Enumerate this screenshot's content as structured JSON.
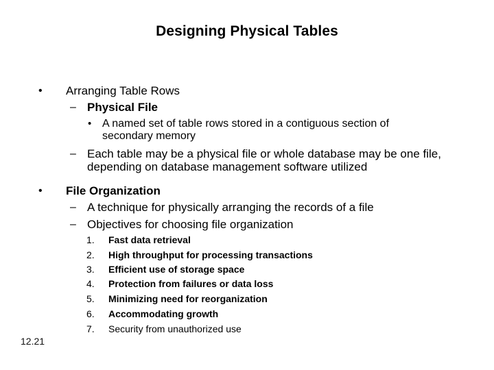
{
  "slide": {
    "title": "Designing Physical Tables",
    "slide_number": "12.21",
    "sections": [
      {
        "marker": "•",
        "heading": "Arranging Table Rows",
        "items": [
          {
            "marker": "–",
            "text": "Physical File",
            "subitems": [
              {
                "marker": "•",
                "line1": "A named set of table rows stored in a contiguous section of",
                "line2": "secondary memory"
              }
            ]
          },
          {
            "marker": "–",
            "line1": "Each table may be a physical file or whole database may be one file,",
            "line2": "depending on database management software utilized"
          }
        ]
      },
      {
        "marker": "•",
        "heading": "File Organization",
        "items": [
          {
            "marker": "–",
            "text": "A technique for physically arranging the records of a file"
          },
          {
            "marker": "–",
            "text": "Objectives for choosing file organization"
          }
        ],
        "objectives": [
          {
            "num": "1.",
            "text": "Fast data retrieval"
          },
          {
            "num": "2.",
            "text": "High throughput for processing transactions"
          },
          {
            "num": "3.",
            "text": "Efficient use of storage space"
          },
          {
            "num": "4.",
            "text": "Protection from failures or data loss"
          },
          {
            "num": "5.",
            "text": "Minimizing need for reorganization"
          },
          {
            "num": "6.",
            "text": "Accommodating growth"
          },
          {
            "num": "7.",
            "text": "Security from unauthorized use"
          }
        ]
      }
    ]
  }
}
